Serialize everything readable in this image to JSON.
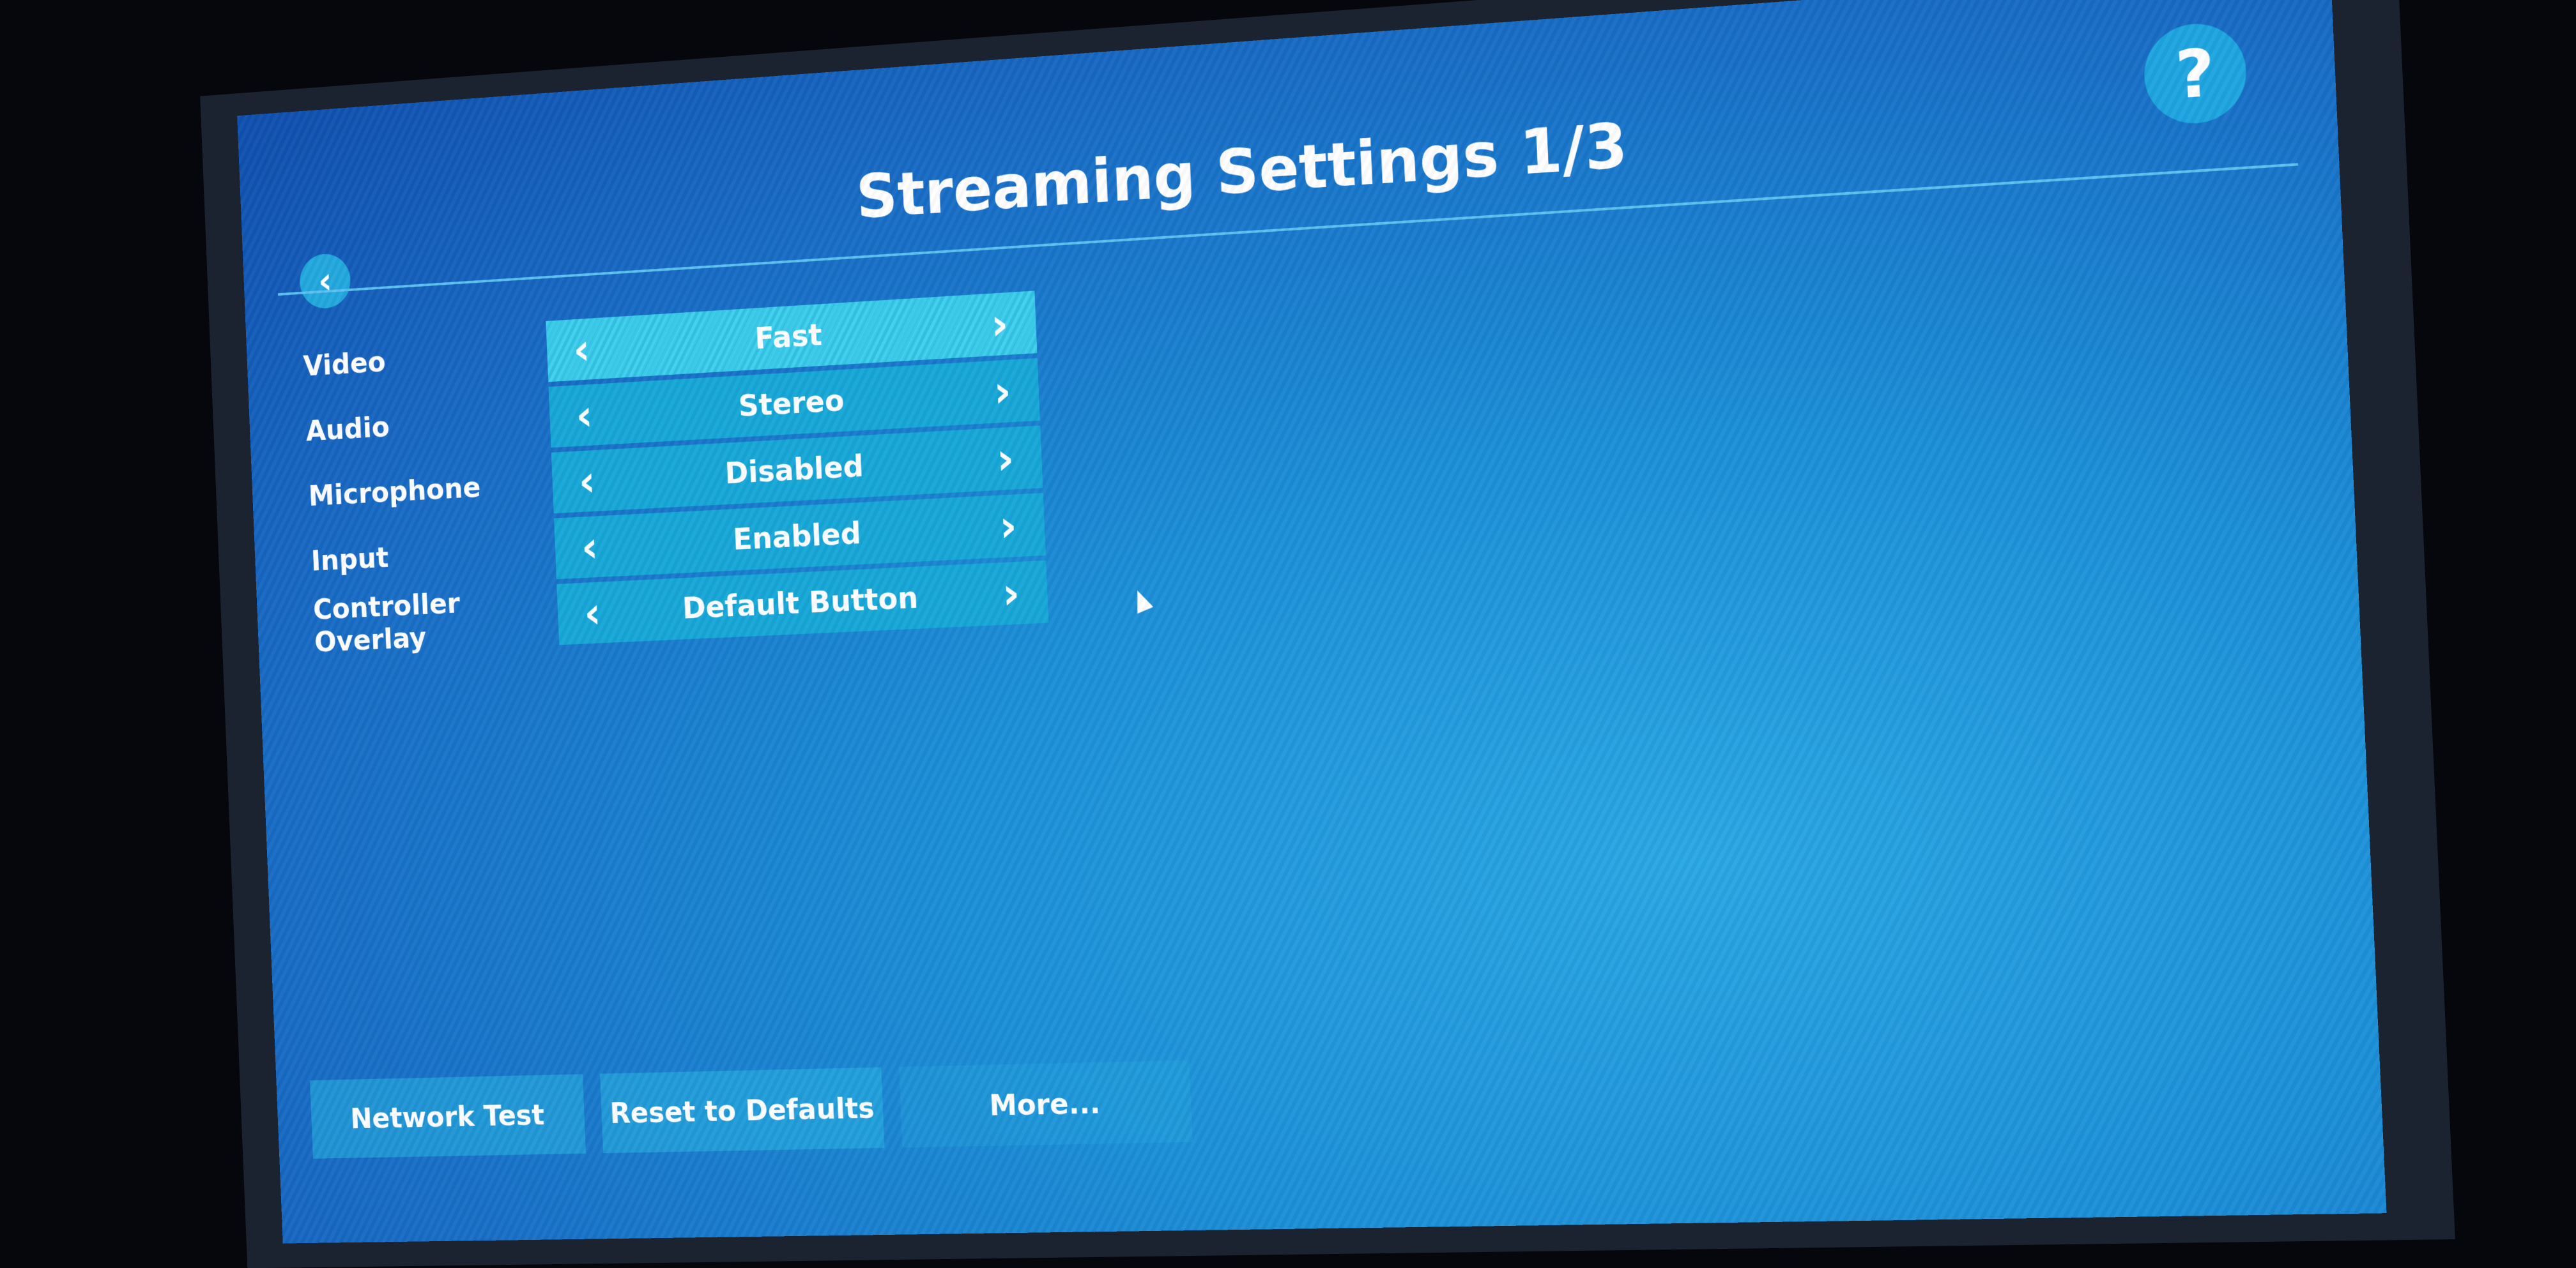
{
  "header": {
    "title": "Streaming Settings 1/3",
    "back_icon": "chevron-left-icon",
    "help_label": "?"
  },
  "settings": [
    {
      "label": "Video",
      "value": "Fast",
      "selected": true
    },
    {
      "label": "Audio",
      "value": "Stereo",
      "selected": false
    },
    {
      "label": "Microphone",
      "value": "Disabled",
      "selected": false
    },
    {
      "label": "Input",
      "value": "Enabled",
      "selected": false
    },
    {
      "label": "Controller Overlay",
      "value": "Default Button",
      "selected": false
    }
  ],
  "arrows": {
    "prev": "‹",
    "next": "›",
    "back": "‹"
  },
  "footer": {
    "network_test": "Network Test",
    "reset_defaults": "Reset to Defaults",
    "more": "More..."
  },
  "colors": {
    "background": "#1b8fd8",
    "selector": "#17a7d8",
    "selector_active": "#3fd0ee",
    "accent": "#1ea5e0"
  }
}
